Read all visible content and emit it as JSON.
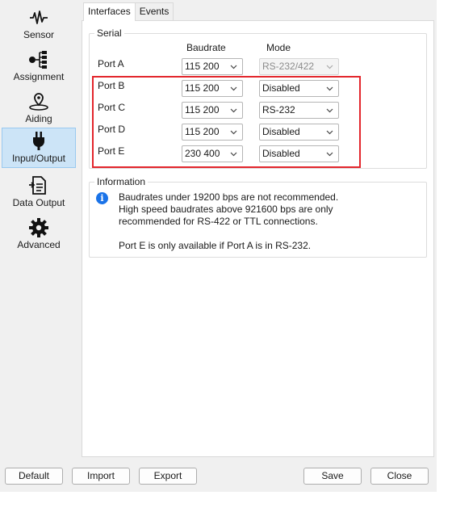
{
  "sidebar": {
    "items": [
      {
        "label": "Sensor",
        "icon": "signal-wave-icon"
      },
      {
        "label": "Assignment",
        "icon": "tree-diagram-icon"
      },
      {
        "label": "Aiding",
        "icon": "map-pin-icon"
      },
      {
        "label": "Input/Output",
        "icon": "plug-icon"
      },
      {
        "label": "Data Output",
        "icon": "document-arrow-icon"
      },
      {
        "label": "Advanced",
        "icon": "gear-icon"
      }
    ],
    "active": "Input/Output"
  },
  "tabs": {
    "interfaces": "Interfaces",
    "events": "Events"
  },
  "serial": {
    "title": "Serial",
    "col_baudrate": "Baudrate",
    "col_mode": "Mode",
    "ports": [
      {
        "label": "Port A",
        "baudrate": "115 200",
        "mode": "RS-232/422"
      },
      {
        "label": "Port B",
        "baudrate": "115 200",
        "mode": "Disabled"
      },
      {
        "label": "Port C",
        "baudrate": "115 200",
        "mode": "RS-232"
      },
      {
        "label": "Port D",
        "baudrate": "115 200",
        "mode": "Disabled"
      },
      {
        "label": "Port E",
        "baudrate": "230 400",
        "mode": "Disabled"
      }
    ]
  },
  "information": {
    "title": "Information",
    "lines": [
      "Baudrates under 19200 bps are not recommended.",
      "High speed baudrates above 921600 bps are only",
      "recommended for RS-422 or TTL connections.",
      "",
      "Port E is only available if Port A is in RS-232."
    ]
  },
  "buttons": {
    "default": "Default",
    "import": "Import",
    "export": "Export",
    "save": "Save",
    "close": "Close"
  },
  "colors": {
    "accent": "#1a73e8",
    "highlight": "#e3262c",
    "active_bg": "#cce4f7"
  }
}
